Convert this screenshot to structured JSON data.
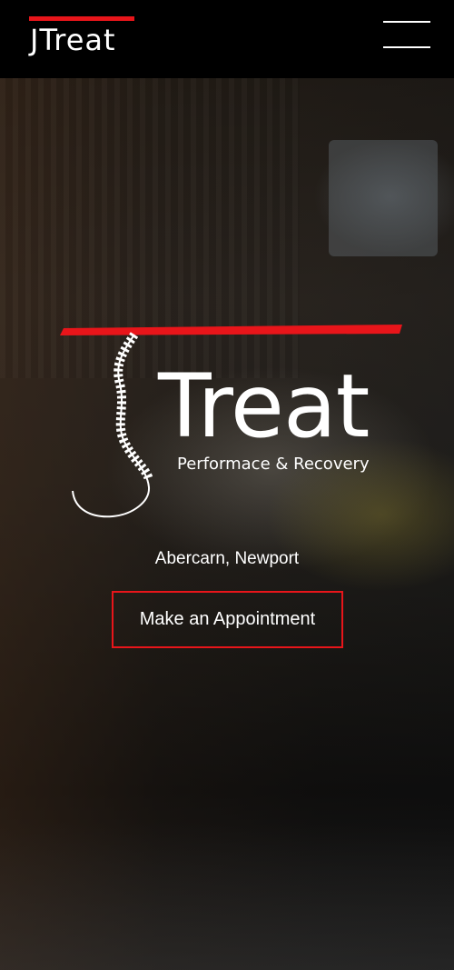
{
  "header": {
    "brand": "JTreat",
    "menu_icon": "hamburger-menu-icon"
  },
  "hero": {
    "logo_word": "Treat",
    "logo_tagline": "Performace & Recovery",
    "location": "Abercarn, Newport",
    "cta_label": "Make an Appointment"
  },
  "colors": {
    "accent": "#e8151a",
    "header_bg": "#000000",
    "text": "#ffffff"
  }
}
